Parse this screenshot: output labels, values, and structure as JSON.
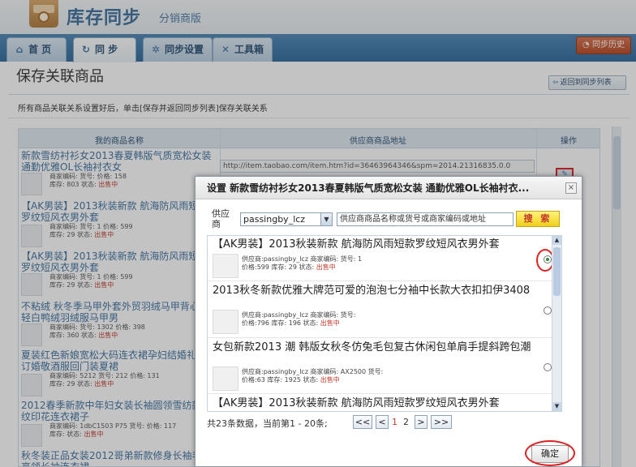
{
  "app": {
    "title": "库存同步",
    "subtitle": "分销商版"
  },
  "nav": {
    "tabs": [
      {
        "label": "首 页",
        "icon": "home-icon"
      },
      {
        "label": "同 步",
        "icon": "sync-icon"
      },
      {
        "label": "同步设置",
        "icon": "gear-icon"
      },
      {
        "label": "工具箱",
        "icon": "wrench-icon"
      }
    ],
    "history_button": "同步历史"
  },
  "page": {
    "title": "保存关联商品",
    "back_button": "返回到同步列表",
    "notice": "所有商品关联关系设置好后，单击[保存并返回同步列表]保存关联关系"
  },
  "table": {
    "headers": [
      "我的商品名称",
      "供应商商品地址",
      "操作"
    ],
    "url_value": "http://item.taobao.com/item.htm?id=36463964346&spm=2014.21316835.0.0",
    "rows": [
      {
        "title": "新款雪纺衬衫女2013春夏韩版气质宽松女装 通勤优雅OL长袖衬衣女",
        "l1": "商家编码: 货号: 价格: 158",
        "l2a": "库存: 803 状态: ",
        "status": "出售中"
      },
      {
        "title": "【AK男装】2013秋装新款 航海防风雨短款罗纹短风衣男外套",
        "l1": "商家编码: 货号: 1 价格: 599",
        "l2a": "库存: 29 状态: ",
        "status": "出售中"
      },
      {
        "title": "【AK男装】2013秋装新款 航海防风雨短款罗纹短风衣男外套",
        "l1": "商家编码: 货号: 1 价格: 599",
        "l2a": "库存: 29 状态: ",
        "status": "出售中"
      },
      {
        "title": "不粘绒 秋冬季马甲外套外贸羽绒马甲背心超轻白鸭绒羽绒服马甲男",
        "l1": "商家编码: 货号: 1302 价格: 398",
        "l2a": "库存: 360 状态: ",
        "status": "出售中"
      },
      {
        "title": "夏装红色新娘宽松大码连衣裙孕妇结婚礼服订婚敬酒服回门装夏裙",
        "l1": "商家编码: 5212 货号: 212 价格: 131",
        "l2a": "库存: 29 状态: ",
        "status": "出售中"
      },
      {
        "title": "2012春季新款中年妇女装长袖圆领雪纺款豹纹印花连衣裙子",
        "l1": "商家编码: 1dbC1503 P75 货号: 价格: 117",
        "l2a": "库存: 状态: ",
        "status": "出售中"
      },
      {
        "title": "秋冬装正品女装2012哥弟新款修身长袖毛衣高领长袖连衣裙",
        "l1": "",
        "l2a": "",
        "status": ""
      }
    ]
  },
  "dialog": {
    "title": "设置 新款雪纺衬衫女2013春夏韩版气质宽松女装 通勤优雅OL长袖衬衣...",
    "close": "×",
    "supplier_label": "供应商",
    "supplier_value": "passingby_lcz",
    "search_placeholder": "供应商商品名称或货号或商家编码或地址",
    "search_button": "搜 索",
    "items": [
      {
        "title": "【AK男装】2013秋装新款 航海防风雨短款罗纹短风衣男外套",
        "l1": "供应商:passingby_lcz 商家编码: 货号: 1",
        "l2a": "价格:599 库存: 29 状态: ",
        "status": "出售中"
      },
      {
        "title": "2013秋冬新款优雅大牌范可爱的泡泡七分袖中长款大衣扣扣伊3408",
        "l1": "供应商:passingby_lcz 商家编码: 货号:",
        "l2a": "价格:796 库存: 196 状态: ",
        "status": "出售中"
      },
      {
        "title": "女包新款2013 潮 韩版女秋冬仿兔毛包复古休闲包单肩手提斜跨包潮",
        "l1": "供应商:passingby_lcz 商家编码: AX2500 货号:",
        "l2a": "价格:63 库存: 1925 状态: ",
        "status": "出售中"
      },
      {
        "title": "【AK男装】2013秋装新款 航海防风雨短款罗纹短风衣男外套",
        "l1": "",
        "l2a": "",
        "status": ""
      }
    ],
    "pager_info": "共23条数据，当前第1 - 20条;",
    "pager": {
      "first": "<<",
      "prev": "<",
      "p1": "1",
      "p2": "2",
      "next": ">",
      "last": ">>"
    },
    "ok_button": "确定"
  }
}
